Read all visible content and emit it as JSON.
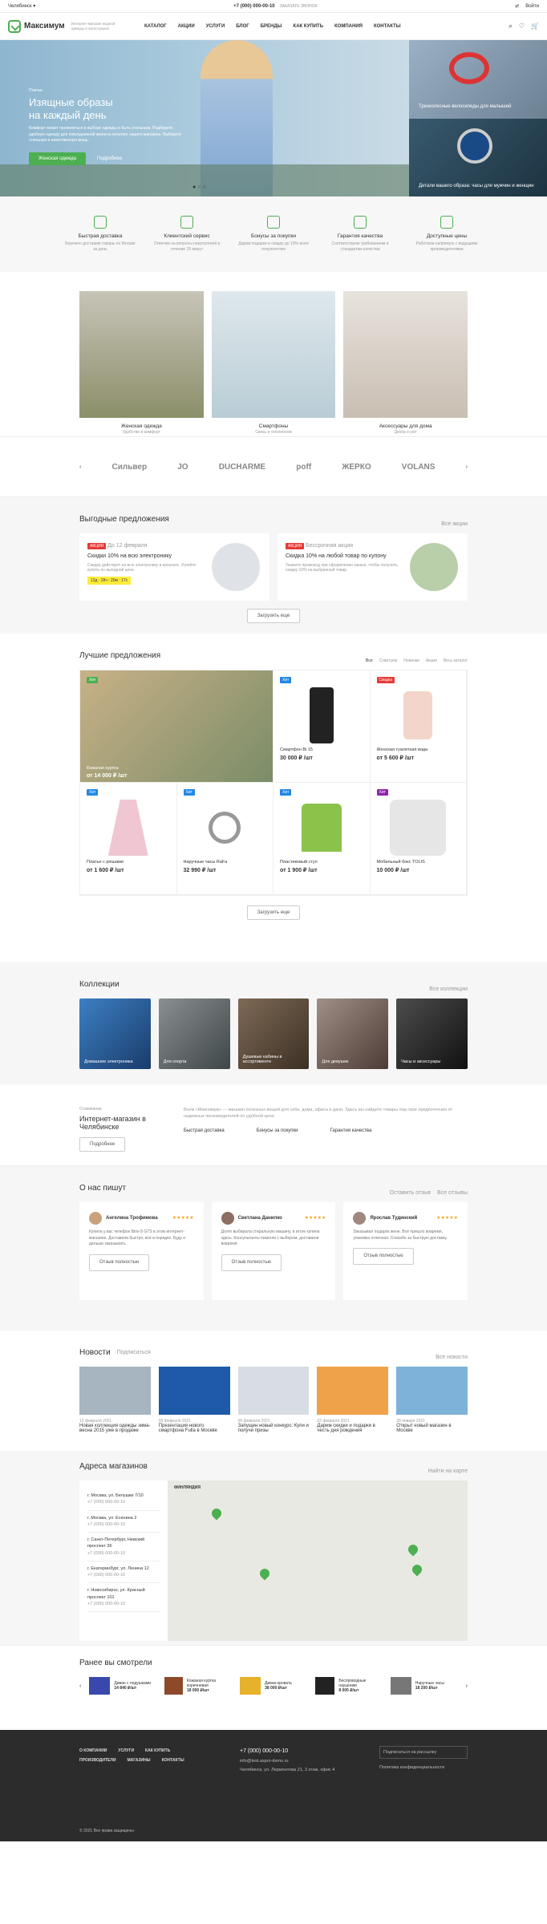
{
  "topbar": {
    "city": "Челябинск",
    "phone": "+7 (000) 000-00-10",
    "callback": "ЗАКАЗАТЬ ЗВОНОК",
    "compare": "Сравн.",
    "login": "Войти"
  },
  "header": {
    "brand": "Максимум",
    "tagline": "Интернет-магазин модной одежды и аксессуаров",
    "nav": [
      "Каталог",
      "Акции",
      "Услуги",
      "Блог",
      "Бренды",
      "Как купить",
      "Компания",
      "Контакты"
    ]
  },
  "hero": {
    "kicker": "Платье",
    "title_line1": "Изящные образы",
    "title_line2": "на каждый день",
    "text": "Комфорт может проявляться в выборе одежды и быть стильным. Подберите удобную одежду для повседневной жизни в каталоге нашего магазина. Выберите стильную и качественную вещь.",
    "btn1": "Женская одежда",
    "btn2": "Подробнее",
    "side1": "Трехколесные велосипеды для малышей",
    "side2": "Детали вашего образа: часы для мужчин и женщин"
  },
  "features": [
    {
      "title": "Быстрая доставка",
      "text": "Бережно доставим товары по Москве за день"
    },
    {
      "title": "Клиентский сервис",
      "text": "Ответим на вопросы покупателей в течение 15 минут"
    },
    {
      "title": "Бонусы за покупки",
      "text": "Дарим подарки и скидку до 10% всем покупателям"
    },
    {
      "title": "Гарантия качества",
      "text": "Соответствуем требованиям и стандартам качества"
    },
    {
      "title": "Доступные цены",
      "text": "Работаем напрямую с ведущими производителями"
    }
  ],
  "categories": [
    {
      "title": "Женская одежда",
      "sub": "Удобство и комфорт"
    },
    {
      "title": "Смартфоны",
      "sub": "Связь и технологии"
    },
    {
      "title": "Аксессуары для дома",
      "sub": "Декор и уют"
    }
  ],
  "brands": [
    "Сильвер",
    "JO",
    "DUCHARME",
    "poff",
    "ЖЕРКО",
    "VOLANS"
  ],
  "offers": {
    "title": "Выгодные предложения",
    "all": "Все акции",
    "items": [
      {
        "tag": "АКЦИЯ",
        "date": "До 12 февраля",
        "title": "Скидки 10% на всю электронику",
        "text": "Скидка действует на всю электронику в каталоге. Успейте купить по выгодной цене.",
        "timer": "13д : 18ч : 20м : 17с"
      },
      {
        "tag": "АКЦИЯ",
        "date": "Бессрочная акция",
        "title": "Скидка 10% на любой товар по купону",
        "text": "Укажите промокод при оформлении заказа, чтобы получить скидку 10% на выбранный товар."
      }
    ],
    "more": "Загрузить еще"
  },
  "best": {
    "title": "Лучшие предложения",
    "tabs": [
      "Все",
      "Советуем",
      "Новинки",
      "Акции"
    ],
    "all": "Весь каталог",
    "items": [
      {
        "tag": "Хит",
        "name": "Кожаная куртка",
        "price": "от 14 000 ₽ /шт"
      },
      {
        "tag": "Хит",
        "name": "Смартфон Bi 15",
        "price": "30 000 ₽ /шт"
      },
      {
        "tag": "Скидка",
        "name": "Женская туалетная вода",
        "price": "от 5 600 ₽ /шт"
      },
      {
        "tag": "Хит",
        "name": "Платье с рюшами",
        "price": "от 1 600 ₽ /шт"
      },
      {
        "tag": "Хит",
        "name": "Наручные часы RaFa",
        "price": "32 990 ₽ /шт"
      },
      {
        "tag": "Хит",
        "name": "Пластиковый стул",
        "price": "от 1 900 ₽ /шт"
      },
      {
        "tag": "Хит",
        "name": "Мобильный бокс TOLIS",
        "price": "10 000 ₽ /шт"
      }
    ],
    "more": "Загрузить еще"
  },
  "collections": {
    "title": "Коллекции",
    "all": "Все коллекции",
    "items": [
      "Домашние электроника",
      "Для спорта",
      "Душевые кабины в ассортименте",
      "Для девушек",
      "Часы и аксессуары"
    ]
  },
  "about": {
    "kicker": "О компании",
    "title": "Интернет-магазин в Челябинске",
    "more": "Подробнее",
    "text": "Всем «Максимум» — магазин полезных вещей для себя, дома, офиса и дачи. Здесь вы найдете товары под свое предпочтения от надежных производителей по удобной цене.",
    "features": [
      "Быстрая доставка",
      "Бонусы за покупки",
      "Гарантия качества"
    ]
  },
  "reviews": {
    "title": "О нас пишут",
    "add": "Оставить отзыв",
    "all": "Все отзывы",
    "items": [
      {
        "who": "Ангелина Трофимова",
        "text": "Купила у вас телефон Bine 8 GTS в этом интернет-магазине. Доставили быстро, всё в порядке. Буду и дальше заказывать."
      },
      {
        "who": "Светлана Данилко",
        "text": "Долго выбирала стиральную машину, в итоге купила здесь. Консультанты помогли с выбором, доставили вовремя."
      },
      {
        "who": "Ярослав Тудинский",
        "text": "Заказывал подарок жене. Всё пришло вовремя, упаковка отличная. Спасибо за быструю доставку."
      }
    ],
    "more": "Отзыв полностью"
  },
  "news": {
    "title": "Новости",
    "sub": "Подписаться",
    "all": "Все новости",
    "items": [
      {
        "date": "12 февраля 2021",
        "title": "Новая коллекция одежды зима-весна 2015 уже в продаже"
      },
      {
        "date": "09 февраля 2021",
        "title": "Презентация нового смартфона Fulla в Москве"
      },
      {
        "date": "06 февраля 2021",
        "title": "Запущен новый конкурс: Купи и получи призы"
      },
      {
        "date": "02 февраля 2021",
        "title": "Дарим скидки и подарки в честь дня рождения"
      },
      {
        "date": "28 января 2021",
        "title": "Открыт новый магазин в Москве"
      }
    ]
  },
  "map": {
    "title": "Адреса магазинов",
    "all": "Найти на карте",
    "shops": [
      "г. Москва, ул. Белушки 7/10",
      "г. Москва, ул. Есенина 2",
      "г. Санкт-Петербург, Невский проспект 36",
      "г. Екатеринбург, ул. Ленина 12",
      "г. Новосибирск, ул. Красный проспект 101"
    ],
    "phone": "+7 (000) 000-00-10",
    "label_fin": "ФИНЛЯНДИЯ"
  },
  "recent": {
    "title": "Ранее вы смотрели",
    "items": [
      {
        "name": "Диван с подушками",
        "price": "14 840 ₽/шт"
      },
      {
        "name": "Кожаная куртка коричневая",
        "price": "18 000 ₽/шт"
      },
      {
        "name": "Диван-кровать",
        "price": "38 000 ₽/шт"
      },
      {
        "name": "Беспроводные наушники",
        "price": "8 000 ₽/шт"
      },
      {
        "name": "Наручные часы",
        "price": "18 200 ₽/шт"
      }
    ]
  },
  "footer": {
    "links": [
      "О компании",
      "Услуги",
      "Как купить",
      "Производители",
      "Магазины",
      "Контакты"
    ],
    "phone": "+7 (000) 000-00-10",
    "email": "info@test.aspro-demo.ru",
    "address": "Челябинск, ул. Лермонтова 21, 3 этаж, офис 4",
    "subscribe": "Подписаться на рассылку",
    "policy": "Политика конфиденциальности",
    "copyright": "© 2021 Все права защищены"
  },
  "colors": {
    "accent": "#4caf50",
    "dark": "#2c2c2c"
  }
}
